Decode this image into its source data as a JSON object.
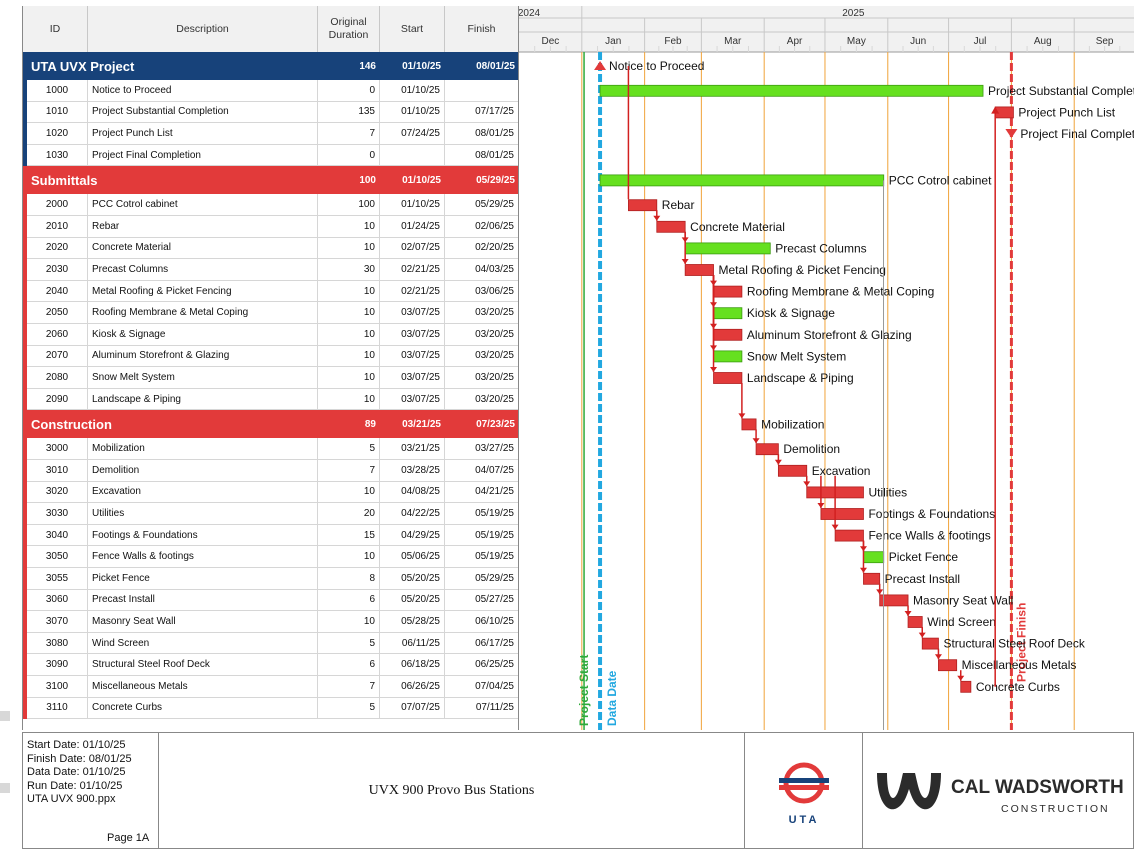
{
  "table": {
    "headers": {
      "id": "ID",
      "description": "Description",
      "duration": "Original Duration",
      "start": "Start",
      "finish": "Finish"
    }
  },
  "groups": [
    {
      "name": "UTA UVX Project",
      "duration": "146",
      "start": "01/10/25",
      "finish": "08/01/25",
      "color": "#17427a",
      "rows": [
        {
          "id": "1000",
          "desc": "Notice to Proceed",
          "dur": "0",
          "start": "01/10/25",
          "finish": ""
        },
        {
          "id": "1010",
          "desc": "Project Substantial Completion",
          "dur": "135",
          "start": "01/10/25",
          "finish": "07/17/25"
        },
        {
          "id": "1020",
          "desc": "Project Punch List",
          "dur": "7",
          "start": "07/24/25",
          "finish": "08/01/25"
        },
        {
          "id": "1030",
          "desc": "Project Final Completion",
          "dur": "0",
          "start": "",
          "finish": "08/01/25"
        }
      ]
    },
    {
      "name": "Submittals",
      "duration": "100",
      "start": "01/10/25",
      "finish": "05/29/25",
      "color": "#e23a3a",
      "rows": [
        {
          "id": "2000",
          "desc": "PCC Cotrol cabinet",
          "dur": "100",
          "start": "01/10/25",
          "finish": "05/29/25"
        },
        {
          "id": "2010",
          "desc": "Rebar",
          "dur": "10",
          "start": "01/24/25",
          "finish": "02/06/25"
        },
        {
          "id": "2020",
          "desc": "Concrete Material",
          "dur": "10",
          "start": "02/07/25",
          "finish": "02/20/25"
        },
        {
          "id": "2030",
          "desc": "Precast Columns",
          "dur": "30",
          "start": "02/21/25",
          "finish": "04/03/25"
        },
        {
          "id": "2040",
          "desc": "Metal Roofing & Picket Fencing",
          "dur": "10",
          "start": "02/21/25",
          "finish": "03/06/25"
        },
        {
          "id": "2050",
          "desc": "Roofing Membrane & Metal Coping",
          "dur": "10",
          "start": "03/07/25",
          "finish": "03/20/25"
        },
        {
          "id": "2060",
          "desc": "Kiosk & Signage",
          "dur": "10",
          "start": "03/07/25",
          "finish": "03/20/25"
        },
        {
          "id": "2070",
          "desc": "Aluminum Storefront & Glazing",
          "dur": "10",
          "start": "03/07/25",
          "finish": "03/20/25"
        },
        {
          "id": "2080",
          "desc": "Snow Melt System",
          "dur": "10",
          "start": "03/07/25",
          "finish": "03/20/25"
        },
        {
          "id": "2090",
          "desc": "Landscape & Piping",
          "dur": "10",
          "start": "03/07/25",
          "finish": "03/20/25"
        }
      ]
    },
    {
      "name": "Construction",
      "duration": "89",
      "start": "03/21/25",
      "finish": "07/23/25",
      "color": "#e23a3a",
      "rows": [
        {
          "id": "3000",
          "desc": "Mobilization",
          "dur": "5",
          "start": "03/21/25",
          "finish": "03/27/25"
        },
        {
          "id": "3010",
          "desc": "Demolition",
          "dur": "7",
          "start": "03/28/25",
          "finish": "04/07/25"
        },
        {
          "id": "3020",
          "desc": "Excavation",
          "dur": "10",
          "start": "04/08/25",
          "finish": "04/21/25"
        },
        {
          "id": "3030",
          "desc": "Utilities",
          "dur": "20",
          "start": "04/22/25",
          "finish": "05/19/25"
        },
        {
          "id": "3040",
          "desc": "Footings & Foundations",
          "dur": "15",
          "start": "04/29/25",
          "finish": "05/19/25"
        },
        {
          "id": "3050",
          "desc": "Fence Walls & footings",
          "dur": "10",
          "start": "05/06/25",
          "finish": "05/19/25"
        },
        {
          "id": "3055",
          "desc": "Picket Fence",
          "dur": "8",
          "start": "05/20/25",
          "finish": "05/29/25"
        },
        {
          "id": "3060",
          "desc": "Precast Install",
          "dur": "6",
          "start": "05/20/25",
          "finish": "05/27/25"
        },
        {
          "id": "3070",
          "desc": "Masonry  Seat Wall",
          "dur": "10",
          "start": "05/28/25",
          "finish": "06/10/25"
        },
        {
          "id": "3080",
          "desc": "Wind Screen",
          "dur": "5",
          "start": "06/11/25",
          "finish": "06/17/25"
        },
        {
          "id": "3090",
          "desc": "Structural Steel Roof Deck",
          "dur": "6",
          "start": "06/18/25",
          "finish": "06/25/25"
        },
        {
          "id": "3100",
          "desc": "Miscellaneous Metals",
          "dur": "7",
          "start": "06/26/25",
          "finish": "07/04/25"
        },
        {
          "id": "3110",
          "desc": "Concrete Curbs",
          "dur": "5",
          "start": "07/07/25",
          "finish": "07/11/25"
        }
      ]
    }
  ],
  "chart_data": {
    "type": "gantt",
    "timeline": {
      "years": [
        {
          "label": "2024",
          "months": [
            "Dec"
          ]
        },
        {
          "label": "2025",
          "months": [
            "Jan",
            "Feb",
            "Mar",
            "Apr",
            "May",
            "Jun",
            "Jul",
            "Aug",
            "Sep"
          ]
        }
      ],
      "range": [
        "2024-12-01",
        "2025-09-30"
      ]
    },
    "vertical_markers": [
      {
        "label": "Project Start",
        "date": "2025-01-10",
        "color": "#2eaa3a"
      },
      {
        "label": "Data Date",
        "date": "2025-01-10",
        "color": "#22a8e0"
      },
      {
        "label": "Project Finish",
        "date": "2025-08-01",
        "color": "#e23a3a"
      }
    ],
    "tasks": [
      {
        "label": "Notice to Proceed",
        "start": "2025-01-10",
        "finish": "2025-01-10",
        "kind": "milestone-start",
        "color": "#e23a3a"
      },
      {
        "label": "Project Substantial Completion",
        "start": "2025-01-10",
        "finish": "2025-07-17",
        "kind": "bar",
        "color": "#66e01f"
      },
      {
        "label": "Project Punch List",
        "start": "2025-07-24",
        "finish": "2025-08-01",
        "kind": "bar",
        "color": "#e23a3a"
      },
      {
        "label": "Project Final Completion",
        "start": "2025-08-01",
        "finish": "2025-08-01",
        "kind": "milestone-finish",
        "color": "#e23a3a"
      },
      {
        "label": "",
        "kind": "group"
      },
      {
        "label": "PCC Cotrol cabinet",
        "start": "2025-01-10",
        "finish": "2025-05-29",
        "kind": "bar",
        "color": "#66e01f"
      },
      {
        "label": "Rebar",
        "start": "2025-01-24",
        "finish": "2025-02-06",
        "kind": "bar",
        "color": "#e23a3a"
      },
      {
        "label": "Concrete Material",
        "start": "2025-02-07",
        "finish": "2025-02-20",
        "kind": "bar",
        "color": "#e23a3a"
      },
      {
        "label": "Precast Columns",
        "start": "2025-02-21",
        "finish": "2025-04-03",
        "kind": "bar",
        "color": "#66e01f"
      },
      {
        "label": "Metal Roofing & Picket Fencing",
        "start": "2025-02-21",
        "finish": "2025-03-06",
        "kind": "bar",
        "color": "#e23a3a"
      },
      {
        "label": "Roofing Membrane & Metal Coping",
        "start": "2025-03-07",
        "finish": "2025-03-20",
        "kind": "bar",
        "color": "#e23a3a"
      },
      {
        "label": "Kiosk & Signage",
        "start": "2025-03-07",
        "finish": "2025-03-20",
        "kind": "bar",
        "color": "#66e01f"
      },
      {
        "label": "Aluminum Storefront & Glazing",
        "start": "2025-03-07",
        "finish": "2025-03-20",
        "kind": "bar",
        "color": "#e23a3a"
      },
      {
        "label": "Snow Melt System",
        "start": "2025-03-07",
        "finish": "2025-03-20",
        "kind": "bar",
        "color": "#66e01f"
      },
      {
        "label": "Landscape & Piping",
        "start": "2025-03-07",
        "finish": "2025-03-20",
        "kind": "bar",
        "color": "#e23a3a"
      },
      {
        "label": "",
        "kind": "group"
      },
      {
        "label": "Mobilization",
        "start": "2025-03-21",
        "finish": "2025-03-27",
        "kind": "bar",
        "color": "#e23a3a"
      },
      {
        "label": "Demolition",
        "start": "2025-03-28",
        "finish": "2025-04-07",
        "kind": "bar",
        "color": "#e23a3a"
      },
      {
        "label": "Excavation",
        "start": "2025-04-08",
        "finish": "2025-04-21",
        "kind": "bar",
        "color": "#e23a3a"
      },
      {
        "label": "Utilities",
        "start": "2025-04-22",
        "finish": "2025-05-19",
        "kind": "bar",
        "color": "#e23a3a"
      },
      {
        "label": "Footings & Foundations",
        "start": "2025-04-29",
        "finish": "2025-05-19",
        "kind": "bar",
        "color": "#e23a3a"
      },
      {
        "label": "Fence Walls & footings",
        "start": "2025-05-06",
        "finish": "2025-05-19",
        "kind": "bar",
        "color": "#e23a3a"
      },
      {
        "label": "Picket Fence",
        "start": "2025-05-20",
        "finish": "2025-05-29",
        "kind": "bar",
        "color": "#66e01f"
      },
      {
        "label": "Precast Install",
        "start": "2025-05-20",
        "finish": "2025-05-27",
        "kind": "bar",
        "color": "#e23a3a"
      },
      {
        "label": "Masonry  Seat Wall",
        "start": "2025-05-28",
        "finish": "2025-06-10",
        "kind": "bar",
        "color": "#e23a3a"
      },
      {
        "label": "Wind Screen",
        "start": "2025-06-11",
        "finish": "2025-06-17",
        "kind": "bar",
        "color": "#e23a3a"
      },
      {
        "label": "Structural Steel Roof Deck",
        "start": "2025-06-18",
        "finish": "2025-06-25",
        "kind": "bar",
        "color": "#e23a3a"
      },
      {
        "label": "Miscellaneous Metals",
        "start": "2025-06-26",
        "finish": "2025-07-04",
        "kind": "bar",
        "color": "#e23a3a"
      },
      {
        "label": "Concrete Curbs",
        "start": "2025-07-07",
        "finish": "2025-07-11",
        "kind": "bar",
        "color": "#e23a3a"
      }
    ]
  },
  "footer": {
    "start_date": "Start Date:   01/10/25",
    "finish_date": "Finish Date:  08/01/25",
    "data_date": "Data Date:   01/10/25",
    "run_date": "Run Date:    01/10/25",
    "file": "UTA UVX 900.ppx",
    "page": "Page 1A",
    "title": "UVX 900 Provo Bus Stations",
    "uta_label": "UTA",
    "company_name": "CAL WADSWORTH",
    "company_sub": "CONSTRUCTION"
  }
}
